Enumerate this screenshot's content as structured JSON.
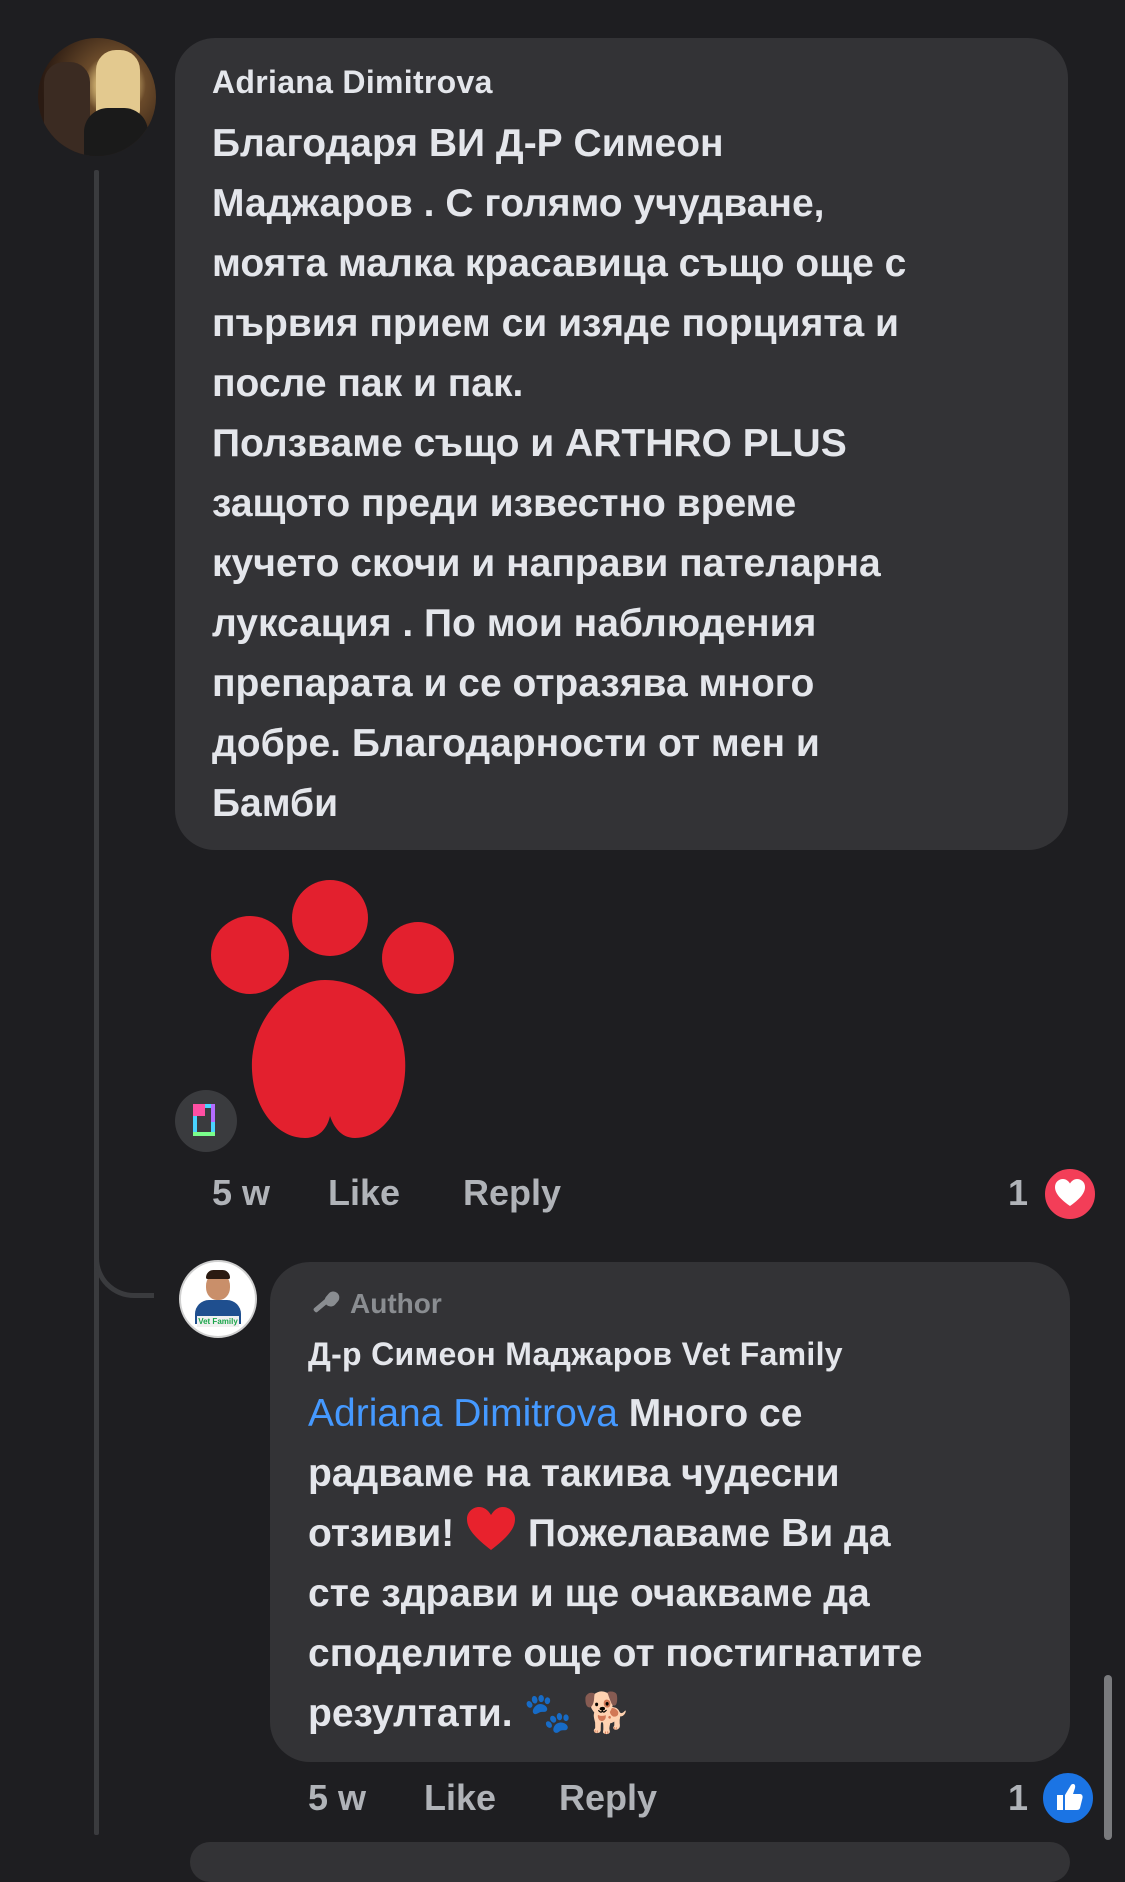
{
  "comments": [
    {
      "author": "Adriana Dimitrova",
      "text": "Благодаря ВИ Д-Р Симеон\nМаджаров . С голямо учудване,\nмоята малка красавица също още с\nпървия прием си изяде  порцията и\nпосле пак и пак.\nПолзваме също и ARTHRO PLUS\nзащото преди известно време\nкучето скочи и направи пателарна\nлуксация . По мои наблюдения\nпрепарата и се отразява много\nдобре. Благодарности от мен и\nБамби",
      "time": "5 w",
      "like_label": "Like",
      "reply_label": "Reply",
      "reaction_count": "1",
      "reaction": "love"
    },
    {
      "badge": "Author",
      "author": "Д-р Симеон Маджаров Vet Family",
      "mention": "Adriana Dimitrova",
      "text_line1": " Много се",
      "text_line2": "радваме на такива чудесни",
      "text_line3a": "отзиви!",
      "text_line3b": " Пожелаваме Ви да",
      "text_line4": "сте здрави и ще очакваме да",
      "text_line5": "споделите още от постигнатите",
      "text_line6": "резултати.",
      "emoji_tail": "🐾 🐕",
      "time": "5 w",
      "like_label": "Like",
      "reply_label": "Reply",
      "reaction_count": "1",
      "reaction": "like",
      "avatar_logo": "Vet Family"
    }
  ],
  "colors": {
    "background": "#1e1e21",
    "bubble": "#333336",
    "mention": "#4599ff",
    "love": "#f33e58",
    "like": "#1b74e4",
    "paw": "#e3202e"
  },
  "icons": [
    "paw-sticker-icon",
    "gif-icon",
    "heart-reaction-icon",
    "thumbs-up-reaction-icon",
    "author-badge-icon",
    "heart-emoji-icon"
  ]
}
